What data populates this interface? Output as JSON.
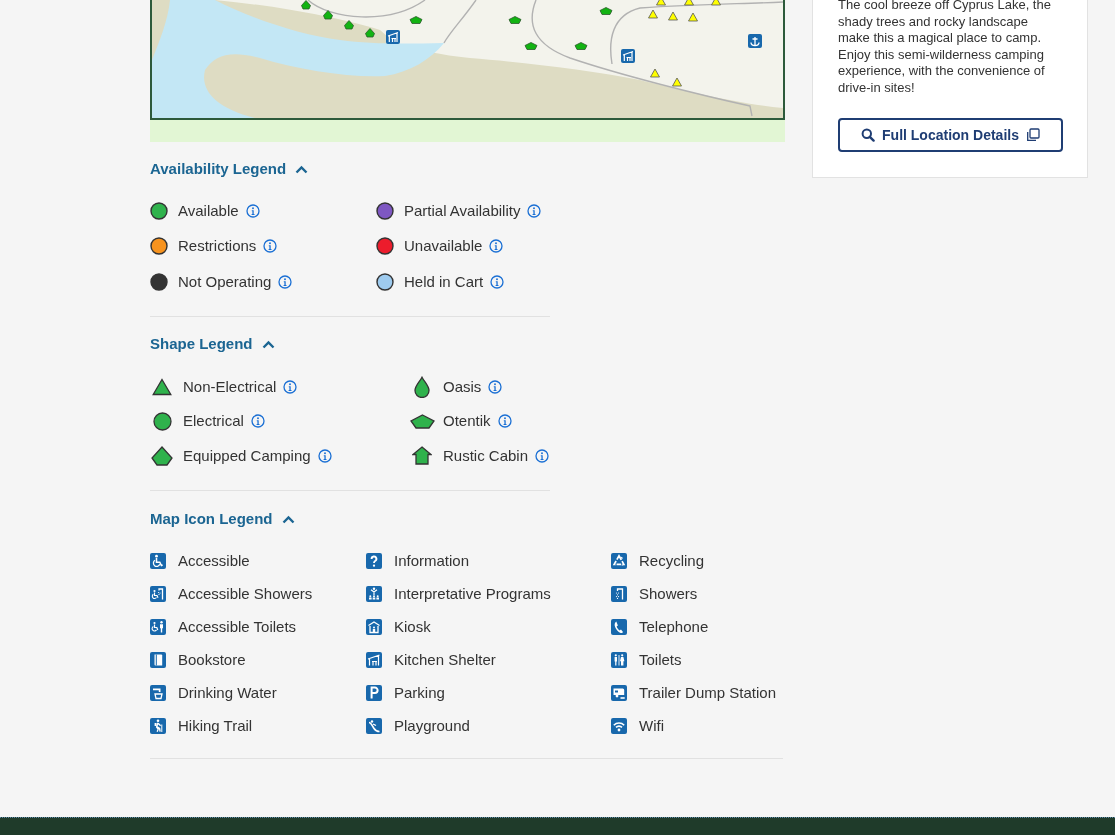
{
  "location_card": {
    "description": "The cool breeze off Cyprus Lake, the shady trees and rocky landscape make this a magical place to camp. Enjoy this semi-wilderness camping experience, with the convenience of drive-in sites!",
    "button": "Full Location Details"
  },
  "availability_legend": {
    "title": "Availability Legend",
    "expanded": true,
    "items": [
      {
        "label": "Available",
        "color": "#2fb24c"
      },
      {
        "label": "Restrictions",
        "color": "#f7931e"
      },
      {
        "label": "Not Operating",
        "color": "#333333"
      },
      {
        "label": "Partial Availability",
        "color": "#7e57c2"
      },
      {
        "label": "Unavailable",
        "color": "#ec1c2c"
      },
      {
        "label": "Held in Cart",
        "color": "#9ecbef"
      }
    ]
  },
  "shape_legend": {
    "title": "Shape Legend",
    "expanded": true,
    "items": [
      {
        "label": "Non-Electrical",
        "kind": "triangle"
      },
      {
        "label": "Electrical",
        "kind": "circle"
      },
      {
        "label": "Equipped Camping",
        "kind": "pentagon"
      },
      {
        "label": "Oasis",
        "kind": "drop"
      },
      {
        "label": "Otentik",
        "kind": "wide-pentagon"
      },
      {
        "label": "Rustic Cabin",
        "kind": "house"
      }
    ]
  },
  "map_icon_legend": {
    "title": "Map Icon Legend",
    "expanded": true,
    "items": [
      {
        "label": "Accessible",
        "kind": "wheelchair"
      },
      {
        "label": "Accessible Showers",
        "kind": "accessible-shower"
      },
      {
        "label": "Accessible Toilets",
        "kind": "accessible-toilet"
      },
      {
        "label": "Bookstore",
        "kind": "book"
      },
      {
        "label": "Drinking Water",
        "kind": "faucet"
      },
      {
        "label": "Hiking Trail",
        "kind": "hiker"
      },
      {
        "label": "Information",
        "kind": "question-mark"
      },
      {
        "label": "Interpretative Programs",
        "kind": "presenter"
      },
      {
        "label": "Kiosk",
        "kind": "kiosk"
      },
      {
        "label": "Kitchen Shelter",
        "kind": "shelter"
      },
      {
        "label": "Parking",
        "kind": "parking"
      },
      {
        "label": "Playground",
        "kind": "slide"
      },
      {
        "label": "Recycling",
        "kind": "recycling"
      },
      {
        "label": "Showers",
        "kind": "shower"
      },
      {
        "label": "Telephone",
        "kind": "telephone"
      },
      {
        "label": "Toilets",
        "kind": "toilets"
      },
      {
        "label": "Trailer Dump Station",
        "kind": "trailer"
      },
      {
        "label": "Wifi",
        "kind": "wifi"
      }
    ]
  }
}
